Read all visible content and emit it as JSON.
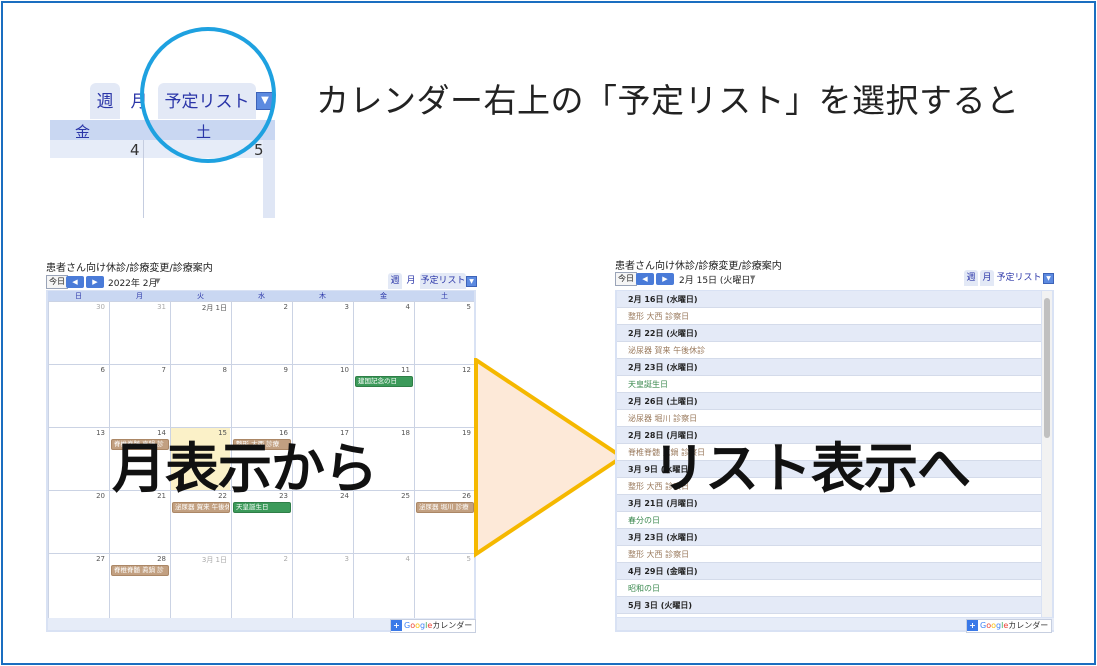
{
  "headline": "カレンダー右上の「予定リスト」を選択すると",
  "zoom": {
    "tabs": {
      "week": "週",
      "month": "月",
      "list": "予定リスト"
    },
    "columns": [
      {
        "label": "金",
        "number": "4"
      },
      {
        "label": "土",
        "number": "5"
      }
    ]
  },
  "month_view": {
    "title": "患者さん向け休診/診療変更/診療案内",
    "today_btn": "今日",
    "nav_prev": "◀",
    "nav_next": "▶",
    "date": "2022年 2月",
    "caret": "▼",
    "tabs": {
      "week": "週",
      "month": "月",
      "list": "予定リスト"
    },
    "weekdays": [
      "日",
      "月",
      "火",
      "水",
      "木",
      "金",
      "土"
    ],
    "weeks": [
      [
        "30",
        "31",
        "2月 1日",
        "2",
        "3",
        "4",
        "5"
      ],
      [
        "6",
        "7",
        "8",
        "9",
        "10",
        "11",
        "12"
      ],
      [
        "13",
        "14",
        "15",
        "16",
        "17",
        "18",
        "19"
      ],
      [
        "20",
        "21",
        "22",
        "23",
        "24",
        "25",
        "26"
      ],
      [
        "27",
        "28",
        "3月 1日",
        "2",
        "3",
        "4",
        "5"
      ]
    ],
    "events": {
      "kenkoku": "建国記念の日",
      "seikei14": "脊椎脊髄 真鍋 診",
      "seikei15": "整形 大西 診療",
      "hinyoki22": "泌尿器 賀来 午後休",
      "tenno23": "天皇誕生日",
      "hinyoki26": "泌尿器 堀川 診療",
      "seikei28": "脊椎脊髄 眞鍋 診"
    }
  },
  "list_view": {
    "title": "患者さん向け休診/診療変更/診療案内",
    "today_btn": "今日",
    "nav_prev": "◀",
    "nav_next": "▶",
    "date": "2月 15日 (火曜日)",
    "caret": "▼",
    "tabs": {
      "week": "週",
      "month": "月",
      "list": "予定リスト"
    },
    "rows": [
      {
        "type": "date",
        "text": "2月 16日 (水曜日)"
      },
      {
        "type": "event-brown",
        "text": "整形 大西 診察日"
      },
      {
        "type": "date",
        "text": "2月 22日 (火曜日)"
      },
      {
        "type": "event-brown",
        "text": "泌尿器 賀来 午後休診"
      },
      {
        "type": "date",
        "text": "2月 23日 (水曜日)"
      },
      {
        "type": "event-green",
        "text": "天皇誕生日"
      },
      {
        "type": "date",
        "text": "2月 26日 (土曜日)"
      },
      {
        "type": "event-brown",
        "text": "泌尿器 堀川 診察日"
      },
      {
        "type": "date",
        "text": "2月 28日 (月曜日)"
      },
      {
        "type": "event-brown",
        "text": "脊椎脊髄 眞鍋 診察日"
      },
      {
        "type": "date",
        "text": "3月 9日 (水曜日)"
      },
      {
        "type": "event-brown",
        "text": "整形 大西 診察日"
      },
      {
        "type": "date",
        "text": "3月 21日 (月曜日)"
      },
      {
        "type": "event-green",
        "text": "春分の日"
      },
      {
        "type": "date",
        "text": "3月 23日 (水曜日)"
      },
      {
        "type": "event-brown",
        "text": "整形 大西 診察日"
      },
      {
        "type": "date",
        "text": "4月 29日 (金曜日)"
      },
      {
        "type": "event-green",
        "text": "昭和の日"
      },
      {
        "type": "date",
        "text": "5月 3日 (火曜日)"
      }
    ]
  },
  "google_badge": {
    "plus": "+",
    "g1": "G",
    "g2": "o",
    "g3": "o",
    "g4": "g",
    "g5": "l",
    "g6": "e",
    "label": "カレンダー"
  },
  "overlay": {
    "left": "月表示から",
    "right": "リスト表示へ"
  },
  "colors": {
    "border": "#1a6ec0",
    "circle": "#1ea1e0",
    "arrow_fill": "#fde9d8",
    "arrow_stroke": "#f5b800",
    "event_green": "#3c9a5a",
    "event_brown": "#c2a081"
  }
}
